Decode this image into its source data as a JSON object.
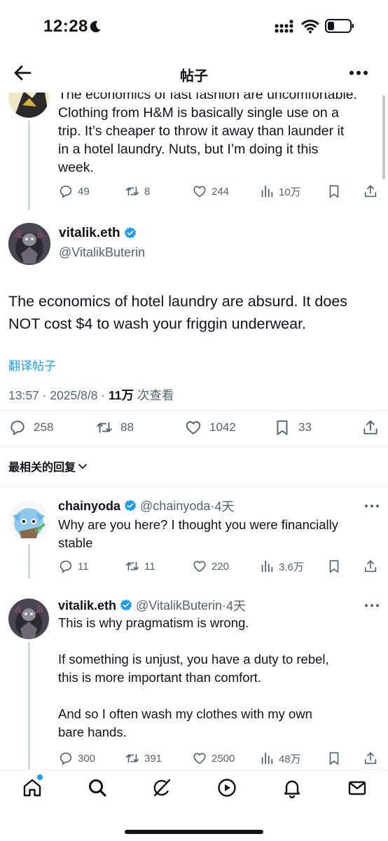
{
  "status_bar": {
    "time": "12:28"
  },
  "header": {
    "title": "帖子"
  },
  "previous_tweet": {
    "text_lines": [
      "The economics of fast fashion are uncomfortable.",
      "Clothing from H&M is basically single use on a",
      "trip.  It’s cheaper to throw it away than launder it",
      "in a hotel laundry.  Nuts, but I’m doing it this",
      "week."
    ],
    "replies": "49",
    "reposts": "8",
    "likes": "244",
    "views": "10万"
  },
  "main_tweet": {
    "display_name": "vitalik.eth",
    "handle": "@VitalikButerin",
    "text_lines": [
      "The economics of hotel laundry are absurd. It does",
      "NOT cost $4 to wash your friggin underwear."
    ],
    "translate_label": "翻译帖子",
    "timestamp": "13:57 · 2025/8/8 · ",
    "view_count": "11万",
    "view_suffix": " 次查看",
    "replies": "258",
    "reposts": "88",
    "likes": "1042",
    "bookmarks": "33"
  },
  "replies_sort": {
    "label": "最相关的回复"
  },
  "replies": [
    {
      "display_name": "chainyoda",
      "handle": "@chainyoda",
      "dot": "·",
      "time": "4天",
      "text_lines": [
        "Why are you here? I thought you were financially",
        "stable"
      ],
      "replies": "11",
      "reposts": "11",
      "likes": "220",
      "views": "3.6万"
    },
    {
      "display_name": "vitalik.eth",
      "handle": "@VitalikButerin",
      "dot": "·",
      "time": "4天",
      "text_lines": [
        "This is why pragmatism is wrong.",
        "",
        "If something is unjust, you have a duty to rebel,",
        "this is more important than comfort.",
        "",
        "And so I often wash my clothes with my own",
        "bare hands."
      ],
      "replies": "300",
      "reposts": "391",
      "likes": "2500",
      "views": "48万"
    }
  ],
  "icons": {
    "reply": "reply-icon",
    "repost": "repost-icon",
    "like": "heart-icon",
    "views": "views-icon",
    "bookmark": "bookmark-icon",
    "share": "share-icon"
  },
  "colors": {
    "accent": "#1d9bf0",
    "secondary_text": "#536471",
    "text": "#0f1419"
  }
}
